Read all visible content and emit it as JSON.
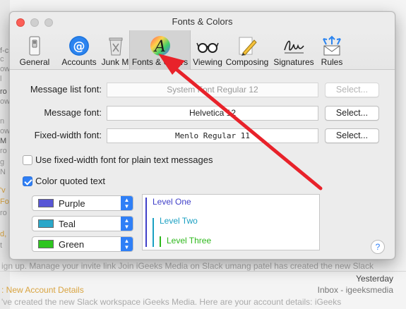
{
  "background": {
    "fragments": [
      "f-c",
      "c",
      "ow",
      "l",
      "ro",
      "ow",
      "n",
      "ow",
      "M",
      "ro",
      "g",
      "N",
      "'v",
      "Fo",
      "ro",
      "d,",
      "t"
    ],
    "row1_text": "ign up. Manage your invite link Join iGeeks Media on Slack umang patel has created the new Slack",
    "row2_right": "Yesterday",
    "row3_left": ": New Account Details",
    "row3_right": "Inbox - igeeksmedia",
    "row4_text": "'ve created the new Slack workspace iGeeks Media. Here are your account details: iGeeks"
  },
  "window": {
    "title": "Fonts & Colors"
  },
  "toolbar": {
    "tabs": [
      {
        "label": "General",
        "icon": "general-switch-icon"
      },
      {
        "label": "Accounts",
        "icon": "at-sign-icon"
      },
      {
        "label": "Junk Mail",
        "icon": "trash-bin-icon"
      },
      {
        "label": "Fonts & Colors",
        "icon": "font-a-icon",
        "active": true
      },
      {
        "label": "Viewing",
        "icon": "glasses-icon"
      },
      {
        "label": "Composing",
        "icon": "pencil-icon"
      },
      {
        "label": "Signatures",
        "icon": "signature-icon"
      },
      {
        "label": "Rules",
        "icon": "envelope-arrows-icon"
      }
    ]
  },
  "fonts": {
    "message_list": {
      "label": "Message list font:",
      "value": "System Font Regular 12",
      "button": "Select..."
    },
    "message": {
      "label": "Message font:",
      "value": "Helvetica 12",
      "button": "Select..."
    },
    "fixed_width": {
      "label": "Fixed-width font:",
      "value": "Menlo Regular 11",
      "button": "Select..."
    }
  },
  "options": {
    "use_fixed_width": {
      "label": "Use fixed-width font for plain text messages",
      "checked": false
    },
    "color_quoted": {
      "label": "Color quoted text",
      "checked": true
    }
  },
  "quote_colors": [
    {
      "name": "Purple",
      "color": "#5856d6"
    },
    {
      "name": "Teal",
      "color": "#2aa7c9"
    },
    {
      "name": "Green",
      "color": "#2ec51f"
    }
  ],
  "preview": {
    "levels": [
      "Level One",
      "Level Two",
      "Level Three"
    ],
    "colors": [
      "#3f3fc8",
      "#1aa0c2",
      "#2eb81c"
    ]
  },
  "help": {
    "label": "?"
  },
  "annotation": {
    "color": "#e8222a"
  }
}
